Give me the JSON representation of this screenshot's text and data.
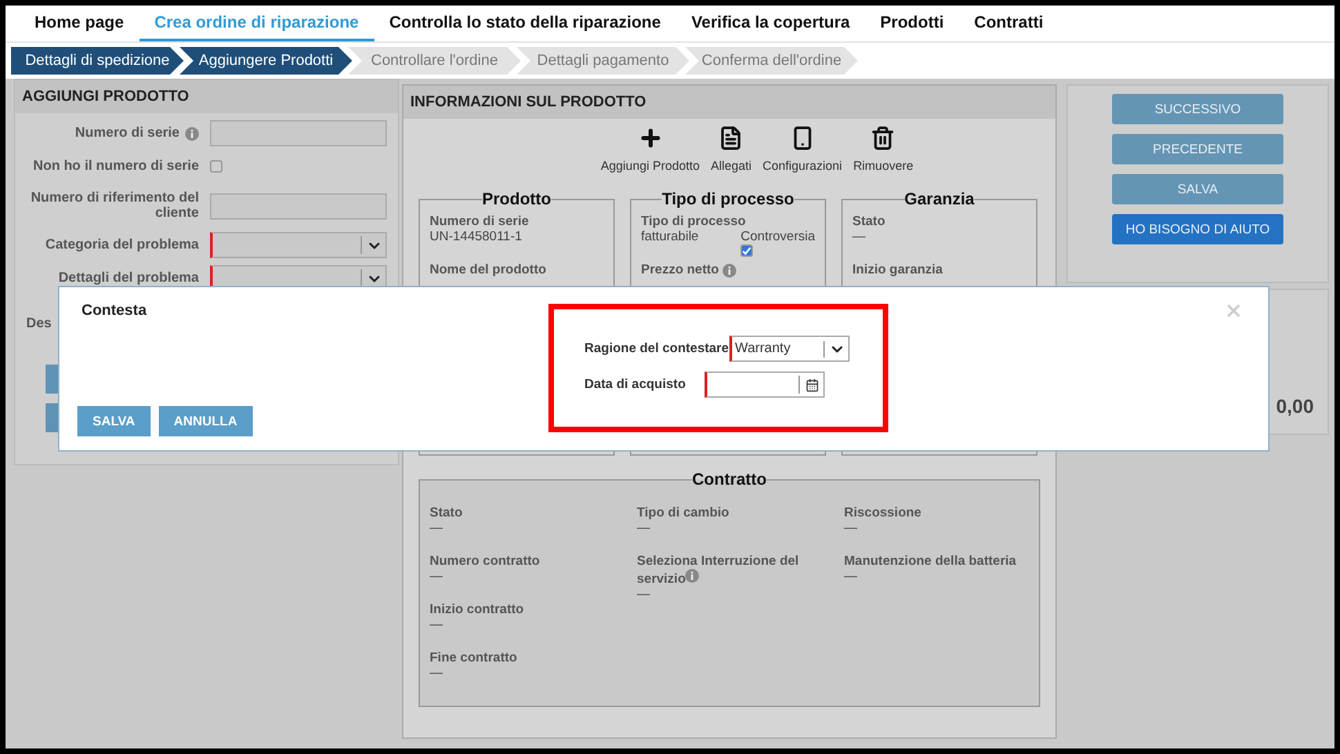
{
  "nav": [
    {
      "label": "Home page",
      "selected": false
    },
    {
      "label": "Crea ordine di riparazione",
      "selected": true
    },
    {
      "label": "Controlla lo stato della riparazione",
      "selected": false
    },
    {
      "label": "Verifica la copertura",
      "selected": false
    },
    {
      "label": "Prodotti",
      "selected": false
    },
    {
      "label": "Contratti",
      "selected": false
    }
  ],
  "steps": [
    {
      "label": "Dettagli di spedizione",
      "completed": true
    },
    {
      "label": "Aggiungere Prodotti",
      "completed": true
    },
    {
      "label": "Controllare l'ordine",
      "completed": false
    },
    {
      "label": "Dettagli pagamento",
      "completed": false
    },
    {
      "label": "Conferma dell'ordine",
      "completed": false
    }
  ],
  "add_product": {
    "title": "AGGIUNGI PRODOTTO",
    "fields": [
      {
        "kind": "text",
        "label": "Numero di serie",
        "info": true,
        "required": false
      },
      {
        "kind": "checkbox",
        "label": "Non ho il numero di serie",
        "checked": false
      },
      {
        "kind": "text",
        "label": "Numero di riferimento del cliente",
        "info": false,
        "required": false
      },
      {
        "kind": "select",
        "label": "Categoria del problema",
        "required": true
      },
      {
        "kind": "select",
        "label": "Dettagli del problema",
        "required": true
      },
      {
        "kind": "label",
        "label": "Des"
      }
    ]
  },
  "product_info": {
    "title": "INFORMAZIONI SUL PRODOTTO",
    "actions": [
      {
        "label": "Aggiungi Prodotto"
      },
      {
        "label": "Allegati"
      },
      {
        "label": "Configurazioni"
      },
      {
        "label": "Rimuovere"
      }
    ],
    "sections": [
      {
        "title": "Prodotto",
        "fields": [
          {
            "label": "Numero di serie",
            "value": "UN-14458011-1"
          },
          {
            "label": "Nome del prodotto"
          }
        ]
      },
      {
        "title": "Tipo di processo",
        "fields": [
          {
            "label": "Tipo di processo",
            "value": "fatturabile",
            "checkbox": {
              "label": "Controversia",
              "checked": true
            }
          },
          {
            "label": "Prezzo netto",
            "info": true
          }
        ]
      },
      {
        "title": "Garanzia",
        "fields": [
          {
            "label": "Stato",
            "value": "—"
          },
          {
            "label": "Inizio garanzia"
          }
        ]
      }
    ],
    "contract": {
      "title": "Contratto",
      "columns": [
        [
          {
            "label": "Stato",
            "value": "—"
          },
          {
            "label": "Numero contratto",
            "value": "—"
          },
          {
            "label": "Inizio contratto",
            "value": "—"
          },
          {
            "label": "Fine contratto",
            "value": "—"
          }
        ],
        [
          {
            "label": "Tipo di cambio",
            "value": "—"
          },
          {
            "label": "Seleziona Interruzione del servizio",
            "info": true,
            "value": "—"
          }
        ],
        [
          {
            "label": "Riscossione",
            "value": "—"
          },
          {
            "label": "Manutenzione della batteria",
            "value": "—"
          }
        ]
      ]
    }
  },
  "actions_panel": {
    "buttons": [
      {
        "label": "SUCCESSIVO",
        "kind": "secondary"
      },
      {
        "label": "PRECEDENTE",
        "kind": "secondary"
      },
      {
        "label": "SALVA",
        "kind": "secondary"
      },
      {
        "label": "HO BISOGNO DI AIUTO",
        "kind": "primary"
      }
    ]
  },
  "summary": {
    "total": "0,00"
  },
  "dialog": {
    "title": "Contesta",
    "highlighted": true,
    "fields": [
      {
        "kind": "select",
        "label": "Ragione del contestare",
        "value": "Warranty",
        "required": true
      },
      {
        "kind": "date",
        "label": "Data di acquisto",
        "required": true
      }
    ],
    "buttons": [
      {
        "label": "SALVA"
      },
      {
        "label": "ANNULLA"
      }
    ]
  }
}
